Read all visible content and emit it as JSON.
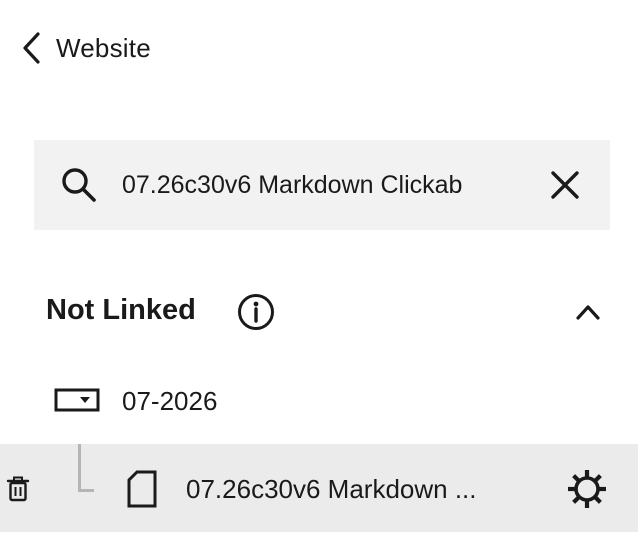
{
  "header": {
    "back_icon": "chevron-left-icon",
    "title": "Website"
  },
  "search": {
    "icon": "search-icon",
    "value": "07.26c30v6 Markdown Clickab",
    "clear_icon": "close-icon"
  },
  "section": {
    "title": "Not Linked",
    "info_icon": "info-icon",
    "collapse_icon": "chevron-up-icon"
  },
  "folder": {
    "icon": "folder-dropdown-icon",
    "label": "07-2026"
  },
  "page_item": {
    "delete_icon": "trash-icon",
    "page_icon": "page-icon",
    "label": "07.26c30v6 Markdown ...",
    "settings_icon": "gear-icon",
    "highlight_color": "#ebebeb"
  }
}
